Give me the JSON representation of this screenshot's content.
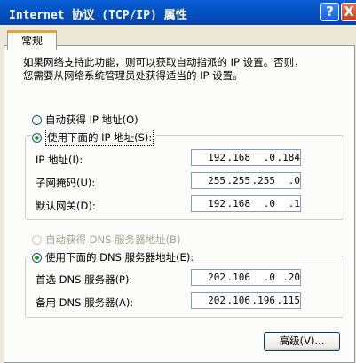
{
  "window": {
    "title": "Internet 协议 (TCP/IP) 属性",
    "help": "?",
    "close": "X"
  },
  "tab": {
    "label": "常规"
  },
  "description": {
    "line1": "如果网络支持此功能，则可以获取自动指派的 IP 设置。否则，",
    "line2": "您需要从网络系统管理员处获得适当的 IP 设置。"
  },
  "ip_mode": {
    "auto": "自动获得 IP 地址(O)",
    "manual": "使用下面的 IP 地址(S):"
  },
  "ip_fields": [
    {
      "label": "IP 地址(I):",
      "octets": [
        "192",
        "168",
        "0",
        "184"
      ]
    },
    {
      "label": "子网掩码(U):",
      "octets": [
        "255",
        "255",
        "255",
        "0"
      ]
    },
    {
      "label": "默认网关(D):",
      "octets": [
        "192",
        "168",
        "0",
        "1"
      ]
    }
  ],
  "dns_mode": {
    "auto": "自动获得 DNS 服务器地址(B)",
    "manual": "使用下面的 DNS 服务器地址(E):"
  },
  "dns_fields": [
    {
      "label": "首选 DNS 服务器(P):",
      "octets": [
        "202",
        "106",
        "0",
        "20"
      ]
    },
    {
      "label": "备用 DNS 服务器(A):",
      "octets": [
        "202",
        "106",
        "196",
        "115"
      ]
    }
  ],
  "advanced_button": "高级(V)..."
}
